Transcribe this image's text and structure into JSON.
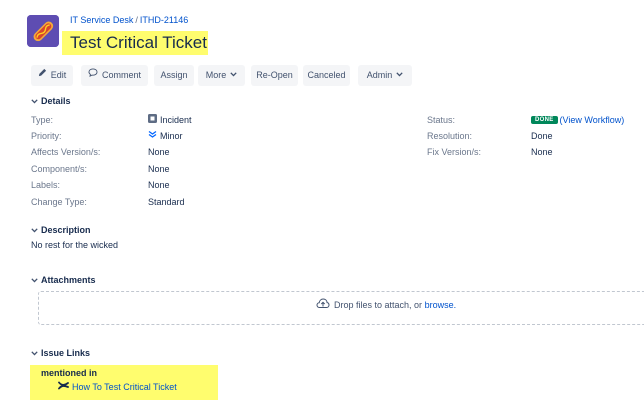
{
  "breadcrumb": {
    "project": "IT Service Desk",
    "separator": "/",
    "issue_key": "ITHD-21146"
  },
  "issue": {
    "title": "Test Critical Ticket"
  },
  "toolbar": {
    "edit": "Edit",
    "comment": "Comment",
    "assign": "Assign",
    "more": "More",
    "reopen": "Re-Open",
    "canceled": "Canceled",
    "admin": "Admin"
  },
  "details": {
    "heading": "Details",
    "type_label": "Type:",
    "type_value": "Incident",
    "priority_label": "Priority:",
    "priority_value": "Minor",
    "affects_label": "Affects Version/s:",
    "affects_value": "None",
    "component_label": "Component/s:",
    "component_value": "None",
    "labels_label": "Labels:",
    "labels_value": "None",
    "change_label": "Change Type:",
    "change_value": "Standard",
    "status_label": "Status:",
    "status_value": "DONE",
    "status_link": "(View Workflow)",
    "resolution_label": "Resolution:",
    "resolution_value": "Done",
    "fix_label": "Fix Version/s:",
    "fix_value": "None"
  },
  "description": {
    "heading": "Description",
    "text": "No rest for the wicked"
  },
  "attachments": {
    "heading": "Attachments",
    "drop_text": "Drop files to attach, or",
    "browse": "browse."
  },
  "issue_links": {
    "heading": "Issue Links",
    "relation": "mentioned in",
    "item": "How To Test Critical Ticket"
  },
  "colors": {
    "highlight": "#fffd6e",
    "link": "#0052cc",
    "done": "#00875a",
    "button_bg": "#f4f5f7"
  },
  "icons": [
    "project-avatar-icon",
    "pencil-icon",
    "comment-icon",
    "chevron-down-icon",
    "incident-icon",
    "minor-priority-icon",
    "upload-cloud-icon",
    "confluence-page-icon"
  ]
}
